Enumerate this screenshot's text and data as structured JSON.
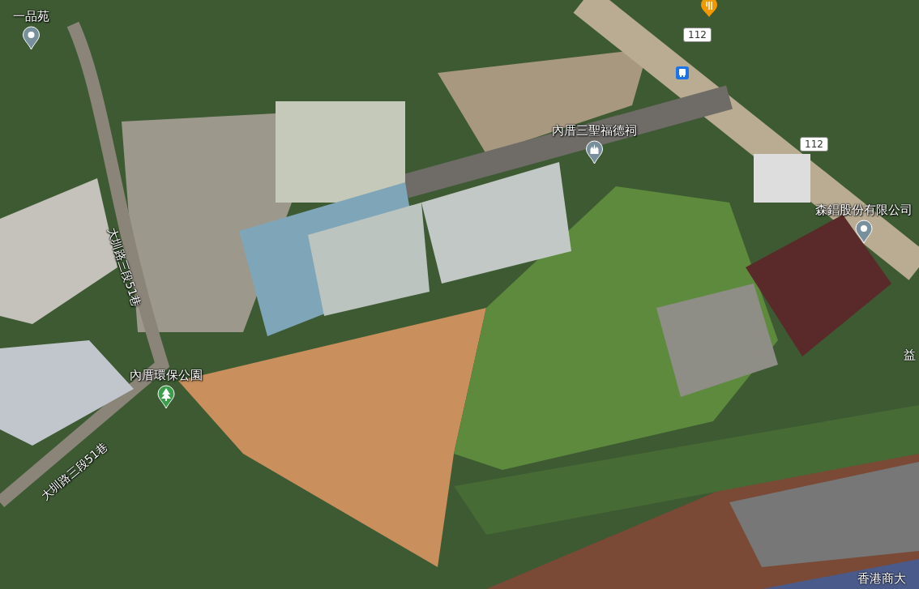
{
  "map": {
    "places": [
      {
        "kind": "place",
        "label": "一品苑"
      },
      {
        "kind": "route",
        "label": "112"
      },
      {
        "kind": "temple",
        "label": "內厝三聖福德祠"
      },
      {
        "kind": "route",
        "label": "112"
      },
      {
        "kind": "place",
        "label": "森錩股份有限公司"
      },
      {
        "kind": "street",
        "label": "大圳路三段51巷"
      },
      {
        "kind": "park",
        "label": "內厝環保公園"
      },
      {
        "kind": "street",
        "label": "大圳路三段51巷"
      },
      {
        "kind": "label",
        "label": "益"
      },
      {
        "kind": "label",
        "label": "香港商大"
      }
    ]
  }
}
